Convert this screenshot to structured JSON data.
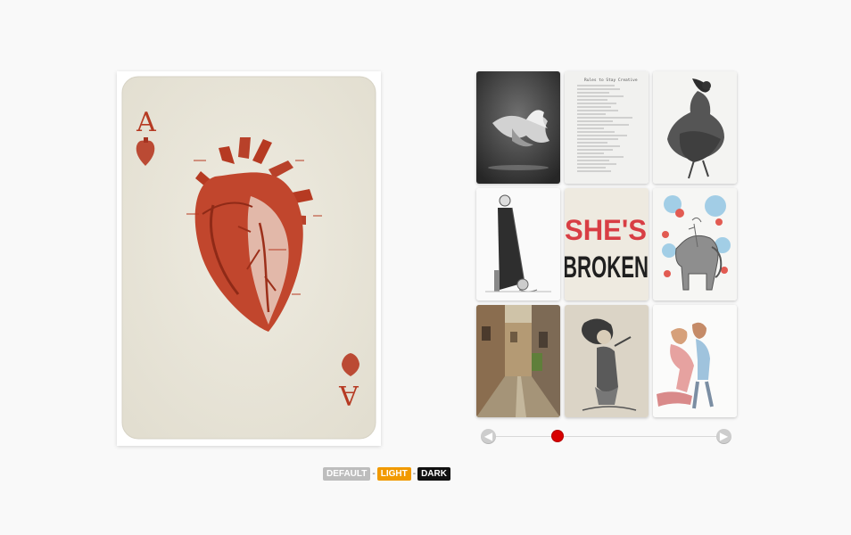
{
  "preview": {
    "card_rank": "A",
    "card_suit": "heart"
  },
  "thumbnails": [
    {
      "name": "fish",
      "kind": "photo"
    },
    {
      "name": "list",
      "kind": "document",
      "title": "Rules to Stay Creative"
    },
    {
      "name": "girl-in-dress",
      "kind": "illustration"
    },
    {
      "name": "tall-coat",
      "kind": "illustration"
    },
    {
      "name": "shes-broken",
      "kind": "typography",
      "line1": "SHE'S",
      "line2": "BROKEN"
    },
    {
      "name": "elephant",
      "kind": "illustration"
    },
    {
      "name": "street",
      "kind": "photo"
    },
    {
      "name": "girl-sketch",
      "kind": "illustration"
    },
    {
      "name": "couple",
      "kind": "illustration"
    }
  ],
  "pager": {
    "prev_icon": "arrow-left-icon",
    "next_icon": "arrow-right-icon",
    "active_page": 1
  },
  "themes": {
    "default_label": "DEFAULT",
    "light_label": "LIGHT",
    "dark_label": "DARK",
    "separator": "-"
  },
  "colors": {
    "background": "#f9f9f9",
    "card_red": "#b63a22",
    "active_dot": "#d80000",
    "default_theme": "#bdbdbd",
    "light_theme": "#f19a00",
    "dark_theme": "#111111"
  }
}
